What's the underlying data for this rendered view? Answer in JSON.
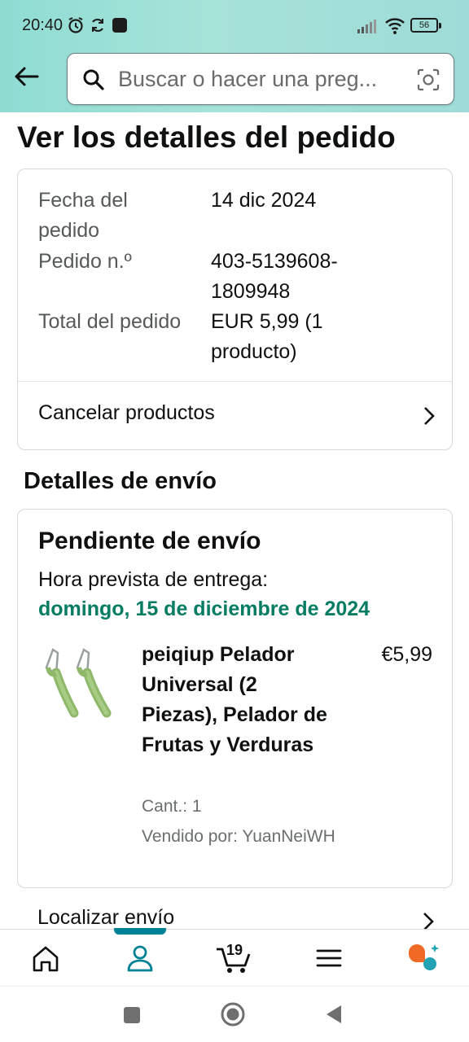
{
  "status_bar": {
    "time": "20:40",
    "battery": "56"
  },
  "search": {
    "placeholder": "Buscar o hacer una preg..."
  },
  "page": {
    "title": "Ver los detalles del pedido"
  },
  "order_summary": {
    "rows": [
      {
        "label": "Fecha del pedido",
        "value": "14 dic 2024"
      },
      {
        "label": "Pedido n.º",
        "value": "403-5139608-1809948"
      },
      {
        "label": "Total del pedido",
        "value": "EUR 5,99 (1 producto)"
      }
    ],
    "cancel_label": "Cancelar productos"
  },
  "shipping": {
    "section_title": "Detalles de envío",
    "status": "Pendiente de envío",
    "eta_label": "Hora prevista de entrega:",
    "eta_date": "domingo, 15 de diciembre de 2024",
    "item": {
      "name": "peiqiup Pelador Universal (2 Piezas), Pelador de Frutas y Verduras",
      "price": "€5,99",
      "qty": "Cant.: 1",
      "seller": "Vendido por: YuanNeiWH",
      "image_icon": "peeler-product-image"
    },
    "track_label": "Localizar envío"
  },
  "bottom_nav": {
    "cart_count": "19",
    "items": [
      "home-icon",
      "account-icon",
      "cart-icon",
      "menu-icon",
      "assistant-icon"
    ],
    "accent": "#008296"
  },
  "colors": {
    "header_bg": "#9fdfd6",
    "eta_green": "#067d62"
  }
}
